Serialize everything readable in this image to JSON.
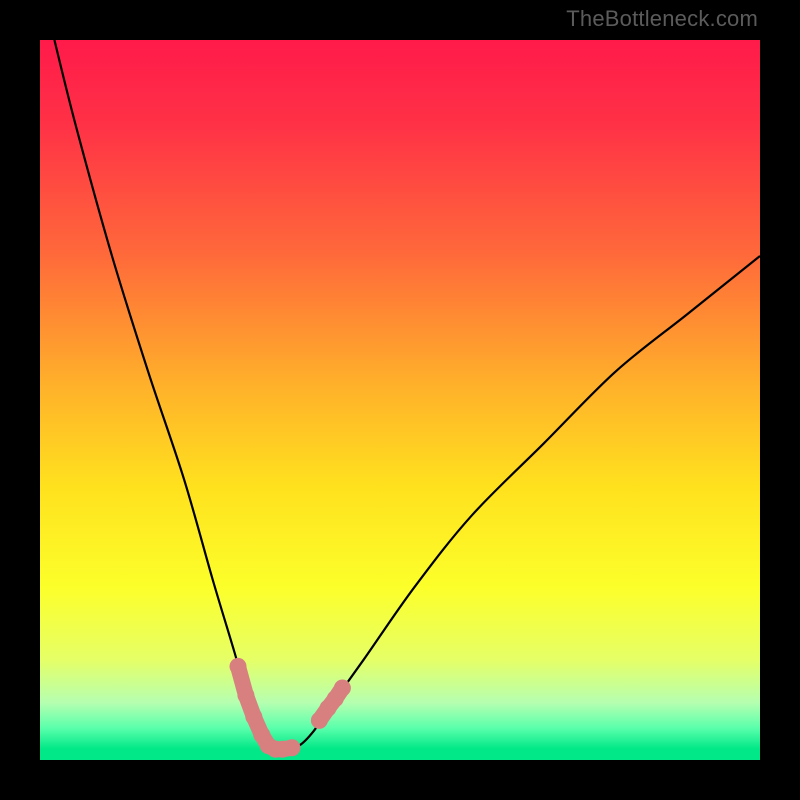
{
  "watermark": {
    "text": "TheBottleneck.com"
  },
  "colors": {
    "gradient_stops": [
      {
        "offset": 0.0,
        "color": "#ff1a4a"
      },
      {
        "offset": 0.12,
        "color": "#ff3246"
      },
      {
        "offset": 0.3,
        "color": "#ff6a3a"
      },
      {
        "offset": 0.48,
        "color": "#ffb12a"
      },
      {
        "offset": 0.62,
        "color": "#ffe11e"
      },
      {
        "offset": 0.76,
        "color": "#fcff2a"
      },
      {
        "offset": 0.86,
        "color": "#e6ff66"
      },
      {
        "offset": 0.92,
        "color": "#b6ffb0"
      },
      {
        "offset": 0.955,
        "color": "#5CFFAC"
      },
      {
        "offset": 0.985,
        "color": "#00E887"
      },
      {
        "offset": 1.0,
        "color": "#00E887"
      }
    ],
    "curve_stroke": "#000000",
    "marker_fill": "#d88080",
    "marker_stroke": "#c26a6a",
    "frame_bg": "#000000"
  },
  "chart_data": {
    "type": "line",
    "title": "",
    "xlabel": "",
    "ylabel": "",
    "xlim": [
      0,
      100
    ],
    "ylim": [
      0,
      100
    ],
    "series": [
      {
        "name": "bottleneck-curve",
        "x": [
          2,
          5,
          10,
          15,
          20,
          24,
          27,
          29,
          31,
          32.5,
          34,
          36,
          38,
          40,
          45,
          52,
          60,
          70,
          80,
          90,
          100
        ],
        "y": [
          100,
          88,
          70,
          54,
          39,
          25,
          15,
          8,
          3,
          1.5,
          1.5,
          2,
          4,
          7,
          14,
          24,
          34,
          44,
          54,
          62,
          70
        ]
      }
    ],
    "markers": [
      {
        "name": "highlight-left",
        "points": [
          {
            "x": 27.5,
            "y": 13
          },
          {
            "x": 28.6,
            "y": 9
          },
          {
            "x": 29.7,
            "y": 6
          },
          {
            "x": 30.8,
            "y": 3.5
          },
          {
            "x": 31.7,
            "y": 2
          },
          {
            "x": 32.7,
            "y": 1.5
          },
          {
            "x": 33.7,
            "y": 1.5
          },
          {
            "x": 35.0,
            "y": 1.7
          }
        ]
      },
      {
        "name": "highlight-right",
        "points": [
          {
            "x": 38.8,
            "y": 5.5
          },
          {
            "x": 40.0,
            "y": 7.2
          },
          {
            "x": 41.0,
            "y": 8.5
          },
          {
            "x": 42.0,
            "y": 10
          }
        ]
      }
    ],
    "note": "y values are bottleneck percentage (0 at perfect match near x≈33, rising toward 100 at extremes). x is a normalized component-match axis."
  }
}
